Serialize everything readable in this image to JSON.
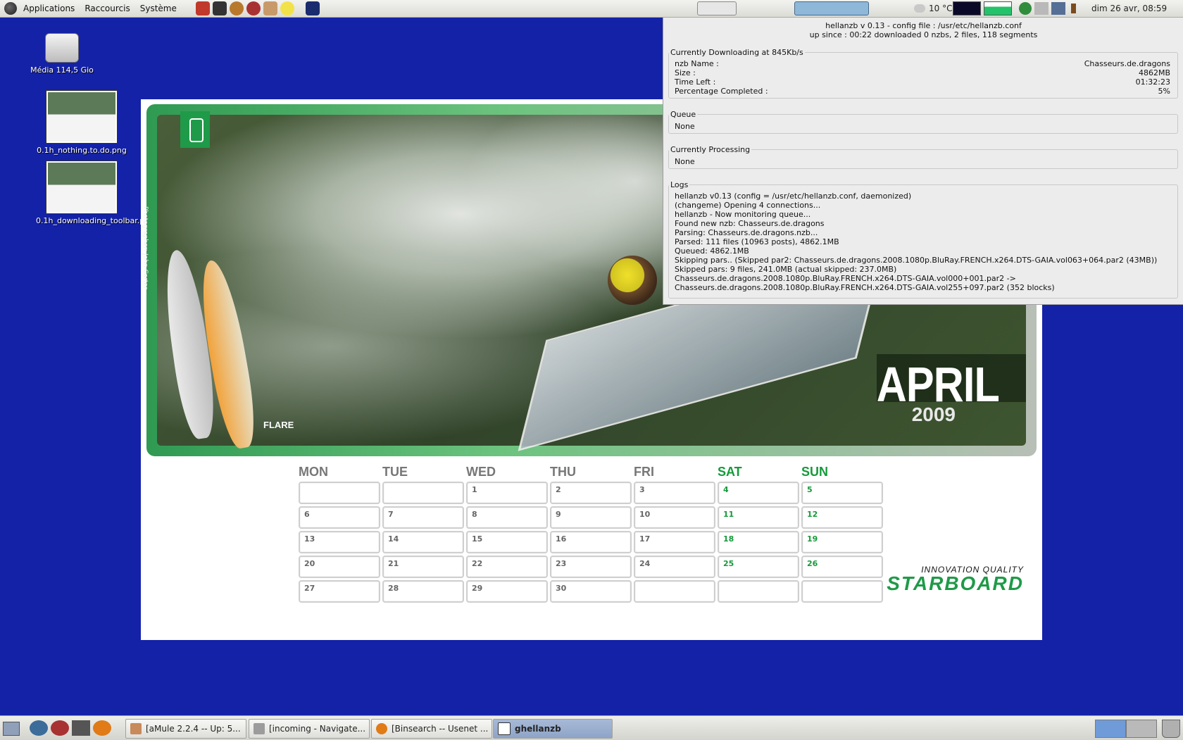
{
  "top_panel": {
    "menus": [
      "Applications",
      "Raccourcis",
      "Système"
    ],
    "weather": "10 °C",
    "clock": "dim 26 avr, 08:59"
  },
  "desktop_icons": [
    {
      "label": "Média 114,5 Gio"
    },
    {
      "label": "0.1h_nothing.to.do.png"
    },
    {
      "label": "0.1h_downloading_toolbar.png"
    }
  ],
  "calendar": {
    "month": "APRIL",
    "year": "2009",
    "photographer": "Photographer: John Carter",
    "board_label": "FLARE",
    "brand_tag": "INNOVATION QUALITY",
    "brand_name": "STARBOARD",
    "day_headers": [
      "MON",
      "TUE",
      "WED",
      "THU",
      "FRI",
      "SAT",
      "SUN"
    ],
    "weeks": [
      [
        "",
        "",
        "1",
        "2",
        "3",
        "4",
        "5"
      ],
      [
        "6",
        "7",
        "8",
        "9",
        "10",
        "11",
        "12"
      ],
      [
        "13",
        "14",
        "15",
        "16",
        "17",
        "18",
        "19"
      ],
      [
        "20",
        "21",
        "22",
        "23",
        "24",
        "25",
        "26"
      ],
      [
        "27",
        "28",
        "29",
        "30",
        "",
        "",
        ""
      ]
    ]
  },
  "hellanzb": {
    "title_line": "hellanzb v 0.13 - config file : /usr/etc/hellanzb.conf",
    "status_line": "up since : 00:22   downloaded  0 nzbs,  2 files,  118 segments",
    "downloading": {
      "legend": "Currently Downloading at 845Kb/s",
      "rows": [
        {
          "label": "nzb Name :",
          "value": "Chasseurs.de.dragons"
        },
        {
          "label": "Size :",
          "value": "4862MB"
        },
        {
          "label": "Time Left :",
          "value": "01:32:23"
        },
        {
          "label": "Percentage Completed :",
          "value": "5%"
        }
      ]
    },
    "queue": {
      "legend": "Queue",
      "value": "None"
    },
    "processing": {
      "legend": "Currently Processing",
      "value": "None"
    },
    "logs": {
      "legend": "Logs",
      "lines": [
        "hellanzb v0.13 (config = /usr/etc/hellanzb.conf, daemonized)",
        "(changeme) Opening 4 connections...",
        "hellanzb - Now monitoring queue...",
        "Found new nzb: Chasseurs.de.dragons",
        "Parsing: Chasseurs.de.dragons.nzb...",
        "Parsed: 111 files (10963 posts), 4862.1MB",
        "Queued: 4862.1MB",
        "Skipping pars.. (Skipped par2: Chasseurs.de.dragons.2008.1080p.BluRay.FRENCH.x264.DTS-GAIA.vol063+064.par2 (43MB))",
        "Skipped pars: 9 files, 241.0MB (actual skipped: 237.0MB)",
        " Chasseurs.de.dragons.2008.1080p.BluRay.FRENCH.x264.DTS-GAIA.vol000+001.par2 ->",
        " Chasseurs.de.dragons.2008.1080p.BluRay.FRENCH.x264.DTS-GAIA.vol255+097.par2 (352 blocks)"
      ]
    }
  },
  "taskbar": {
    "tasks": [
      {
        "label": "[aMule 2.2.4 -- Up: 5...",
        "active": false
      },
      {
        "label": "[incoming - Navigate...",
        "active": false
      },
      {
        "label": "[Binsearch -- Usenet ...",
        "active": false
      },
      {
        "label": "ghellanzb",
        "active": true
      }
    ]
  },
  "colors": {
    "desktop": "#1422a8",
    "accent_green": "#1f9a48",
    "weekend_green": "#159a3a"
  }
}
